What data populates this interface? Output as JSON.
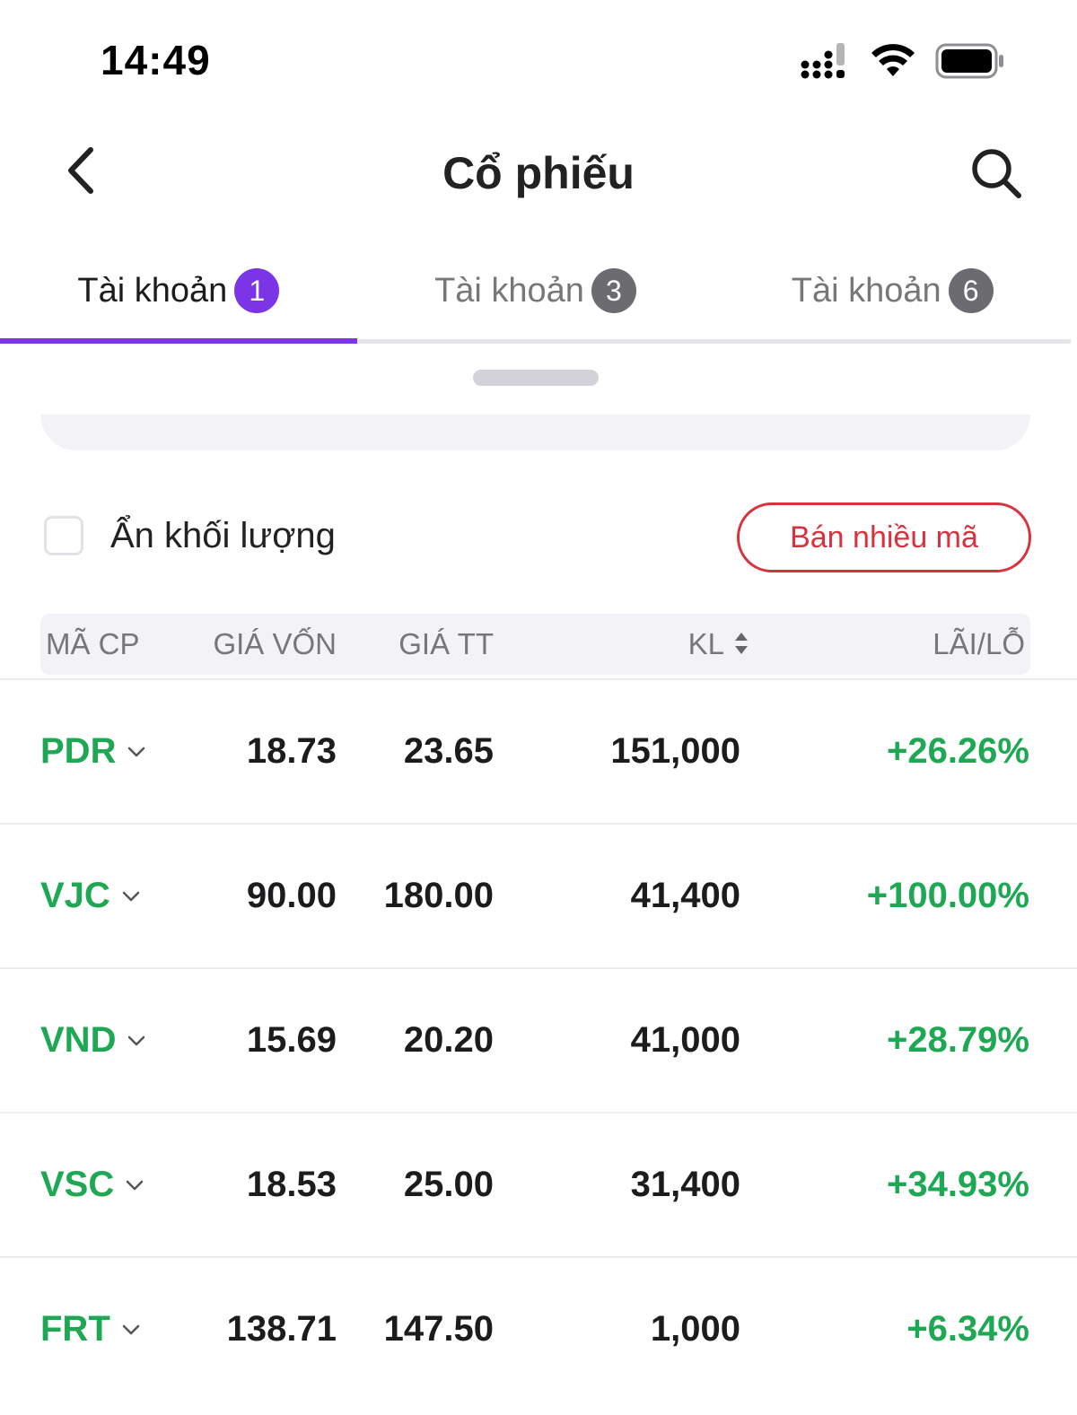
{
  "status_bar": {
    "time": "14:49"
  },
  "nav": {
    "title": "Cổ phiếu",
    "back_icon": "chevron-left-icon",
    "search_icon": "search-icon"
  },
  "tabs": [
    {
      "label": "Tài khoản",
      "badge": "1",
      "active": true
    },
    {
      "label": "Tài khoản",
      "badge": "3",
      "active": false
    },
    {
      "label": "Tài khoản",
      "badge": "6",
      "active": false
    }
  ],
  "options": {
    "hide_volume_label": "Ẩn khối lượng",
    "hide_volume_checked": false,
    "sell_multiple_label": "Bán nhiều mã"
  },
  "table": {
    "headers": {
      "symbol": "MÃ CP",
      "cost_price": "GIÁ VỐN",
      "market_price": "GIÁ TT",
      "volume": "KL",
      "pnl": "LÃI/LỖ"
    },
    "rows": [
      {
        "symbol": "PDR",
        "cost_price": "18.73",
        "market_price": "23.65",
        "volume": "151,000",
        "pnl": "+26.26%"
      },
      {
        "symbol": "VJC",
        "cost_price": "90.00",
        "market_price": "180.00",
        "volume": "41,400",
        "pnl": "+100.00%"
      },
      {
        "symbol": "VND",
        "cost_price": "15.69",
        "market_price": "20.20",
        "volume": "41,000",
        "pnl": "+28.79%"
      },
      {
        "symbol": "VSC",
        "cost_price": "18.53",
        "market_price": "25.00",
        "volume": "31,400",
        "pnl": "+34.93%"
      },
      {
        "symbol": "FRT",
        "cost_price": "138.71",
        "market_price": "147.50",
        "volume": "1,000",
        "pnl": "+6.34%"
      }
    ]
  },
  "colors": {
    "accent": "#7b35e6",
    "positive": "#1fa854",
    "sell": "#d9323f"
  }
}
